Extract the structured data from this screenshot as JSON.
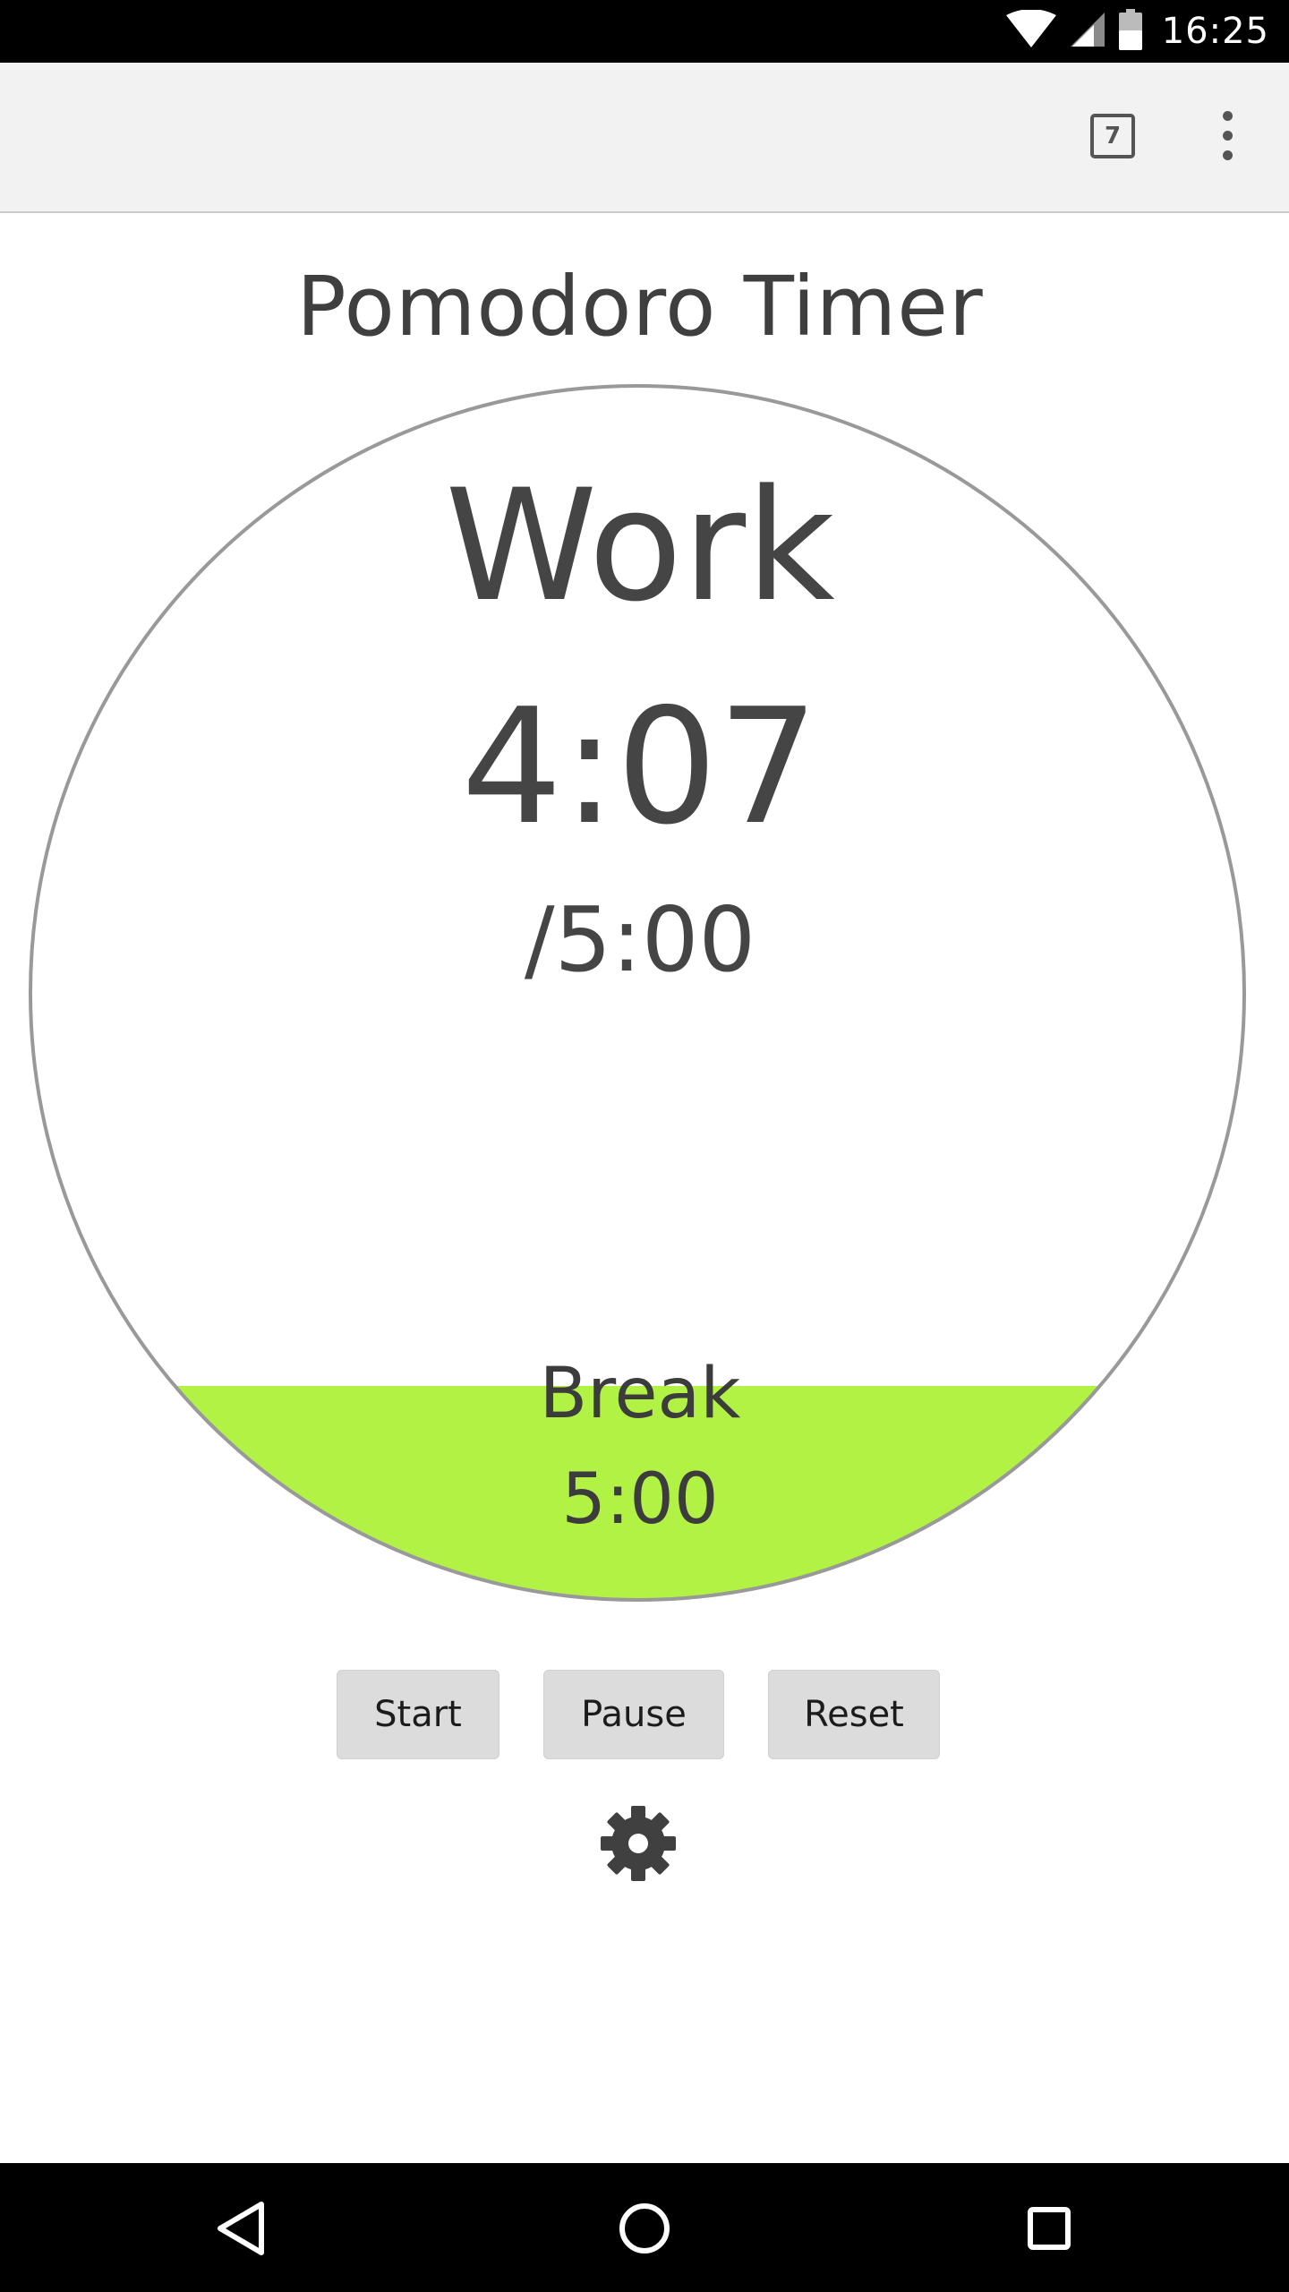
{
  "status_bar": {
    "time": "16:25",
    "icons": [
      "wifi-icon",
      "cell-signal-icon",
      "battery-icon"
    ]
  },
  "toolbar": {
    "tab_count": "7",
    "icons": [
      "tab-switcher-icon",
      "overflow-menu-icon"
    ]
  },
  "page": {
    "title": "Pomodoro Timer"
  },
  "timer": {
    "mode": "Work",
    "elapsed": "4:07",
    "total": "/5:00",
    "progress_fraction": 0.177
  },
  "next_phase": {
    "label": "Break",
    "duration": "5:00"
  },
  "controls": {
    "start_label": "Start",
    "pause_label": "Pause",
    "reset_label": "Reset",
    "settings_icon": "gear-icon"
  },
  "nav_bar": {
    "icons": [
      "back-icon",
      "home-icon",
      "recent-apps-icon"
    ]
  },
  "colors": {
    "fill": "#b2f245",
    "circle_stroke": "#999999",
    "text": "#454545",
    "button_bg": "#dcdcdc"
  }
}
